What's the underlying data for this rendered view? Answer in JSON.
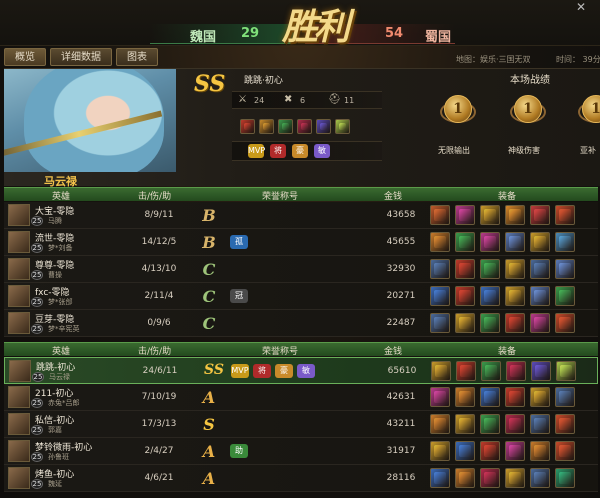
{
  "header": {
    "result_title": "胜利",
    "team_wei": {
      "name": "魏国",
      "score": "29"
    },
    "team_shu": {
      "name": "蜀国",
      "score": "54"
    },
    "map_label": "地图：娱乐·三国无双",
    "time_label": "时间： 39分"
  },
  "tabs": [
    {
      "label": "概览"
    },
    {
      "label": "详细数据"
    },
    {
      "label": "图表"
    }
  ],
  "hero_panel": {
    "hero_name": "马云禄",
    "rank": "SS",
    "player_name": "跳跳·初心",
    "stats": {
      "kills": "24",
      "deaths": "6",
      "assists": "11"
    },
    "equipment_colors": [
      "#c03a2a",
      "#c88a2a",
      "#3a9a4a",
      "#b02a4a",
      "#5a4ab8",
      "#a8c84a"
    ],
    "honors": [
      {
        "label": "MVP",
        "color": "#c89a1a"
      },
      {
        "label": "将",
        "color": "#b02a2a"
      },
      {
        "label": "豪",
        "color": "#c88a2a"
      },
      {
        "label": "敏",
        "color": "#7a5ac8"
      }
    ],
    "battle_title": "本场战绩",
    "medals": [
      {
        "label": "无限输出",
        "num": "1"
      },
      {
        "label": "神级伤害",
        "num": "1"
      },
      {
        "label": "亚补",
        "num": "1"
      }
    ]
  },
  "table_headers": {
    "hero": "英雄",
    "kda": "击/伤/助",
    "honor": "荣誉称号",
    "money": "金钱",
    "items": "装备"
  },
  "team_wei_rows": [
    {
      "name": "大宝-零隐",
      "level": "25",
      "hero": "马腾",
      "kda": "8/9/11",
      "grade": "B",
      "titles": [],
      "money": "43658",
      "items": [
        "#c05a2a",
        "#b83a8a",
        "#c89a2a",
        "#d8882a",
        "#c03a3a",
        "#c84a2a"
      ]
    },
    {
      "name": "流世-零隐",
      "level": "25",
      "hero": "梦*刘备",
      "kda": "14/12/5",
      "grade": "B",
      "titles": [
        {
          "label": "孤",
          "color": "#2a6ab0"
        }
      ],
      "money": "45655",
      "items": [
        "#c87a2a",
        "#3a9a4a",
        "#b83a8a",
        "#5a7ab8",
        "#c89a2a",
        "#4a8ab8"
      ]
    },
    {
      "name": "尊尊-零隐",
      "level": "25",
      "hero": "曹操",
      "kda": "4/13/10",
      "grade": "C",
      "titles": [],
      "money": "32930",
      "items": [
        "#4a6a9a",
        "#c03a2a",
        "#3a9a4a",
        "#c89a2a",
        "#4a6a9a",
        "#5a7ab8"
      ]
    },
    {
      "name": "fxc-零隐",
      "level": "25",
      "hero": "梦*张郃",
      "kda": "2/11/4",
      "grade": "C",
      "titles": [
        {
          "label": "冠",
          "color": "#4a4a4a"
        }
      ],
      "money": "20271",
      "items": [
        "#3a6ab8",
        "#c03a2a",
        "#3a6ab8",
        "#c89a2a",
        "#5a7ab8",
        "#3a9a4a"
      ]
    },
    {
      "name": "豆芽-零隐",
      "level": "25",
      "hero": "梦*辛宪英",
      "kda": "0/9/6",
      "grade": "C",
      "titles": [],
      "money": "22487",
      "items": [
        "#4a6a9a",
        "#c89a2a",
        "#3a9a4a",
        "#c03a2a",
        "#b83a8a",
        "#c84a2a"
      ]
    }
  ],
  "team_shu_rows": [
    {
      "name": "跳跳-初心",
      "level": "25",
      "hero": "马云禄",
      "kda": "24/6/11",
      "grade": "SS",
      "titles": [
        {
          "label": "MVP",
          "color": "#c89a1a"
        },
        {
          "label": "将",
          "color": "#b02a2a"
        },
        {
          "label": "豪",
          "color": "#c88a2a"
        },
        {
          "label": "敏",
          "color": "#7a5ac8"
        }
      ],
      "money": "65610",
      "items": [
        "#c89a2a",
        "#c03a2a",
        "#3a9a4a",
        "#b02a4a",
        "#5a4ab8",
        "#a8c84a"
      ],
      "me": true
    },
    {
      "name": "211-初心",
      "level": "25",
      "hero": "赤兔*吕郎",
      "kda": "7/10/19",
      "grade": "A",
      "titles": [],
      "money": "42631",
      "items": [
        "#b83a8a",
        "#c87a2a",
        "#3a6ab8",
        "#c03a2a",
        "#c89a2a",
        "#4a6a9a"
      ]
    },
    {
      "name": "私信-初心",
      "level": "25",
      "hero": "郭嘉",
      "kda": "17/3/13",
      "grade": "S",
      "titles": [],
      "money": "43211",
      "items": [
        "#c87a2a",
        "#c89a2a",
        "#3a9a4a",
        "#b02a4a",
        "#4a6a9a",
        "#c84a2a"
      ]
    },
    {
      "name": "梦铃微雨-初心",
      "level": "25",
      "hero": "孙鲁班",
      "kda": "2/4/27",
      "grade": "A",
      "titles": [
        {
          "label": "助",
          "color": "#3a8a3a"
        }
      ],
      "money": "31917",
      "items": [
        "#c89a2a",
        "#3a6ab8",
        "#c03a2a",
        "#b83a8a",
        "#c87a2a",
        "#c84a2a"
      ]
    },
    {
      "name": "烤鱼-初心",
      "level": "25",
      "hero": "魏延",
      "kda": "4/6/21",
      "grade": "A",
      "titles": [],
      "money": "28116",
      "items": [
        "#3a6ab8",
        "#c87a2a",
        "#b02a4a",
        "#c89a2a",
        "#4a6a9a",
        "#2a9a6a"
      ]
    }
  ]
}
